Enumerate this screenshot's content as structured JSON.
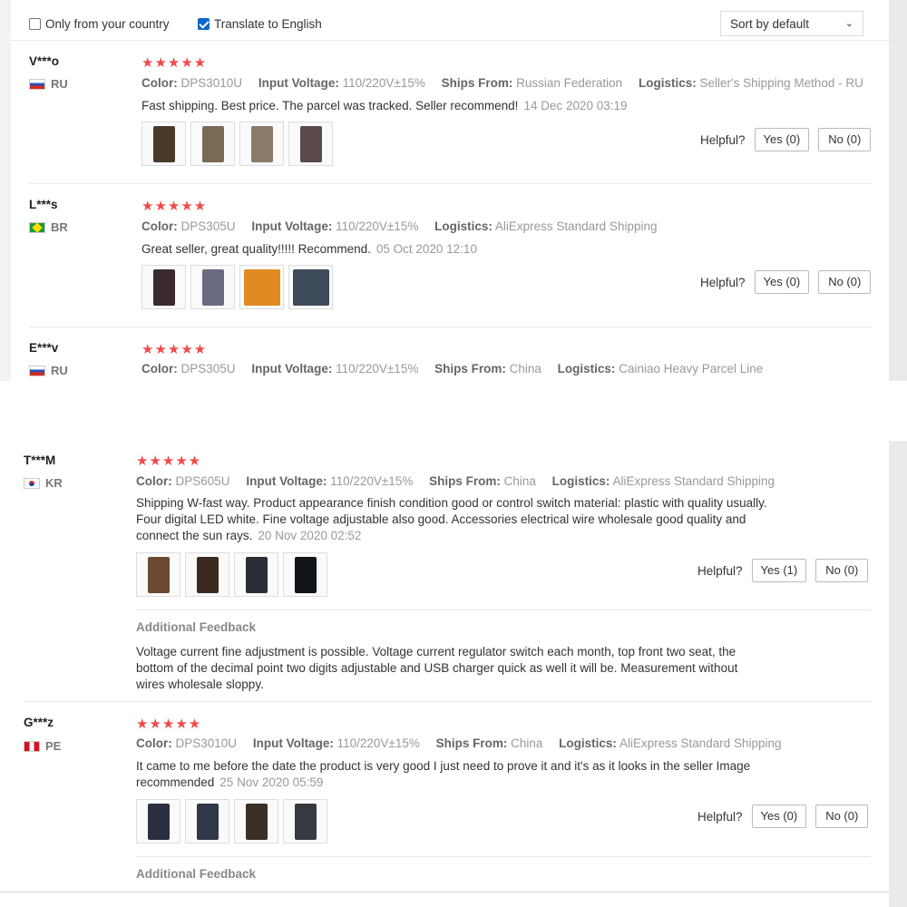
{
  "filters": {
    "only_country_label": "Only from your country",
    "only_country_checked": false,
    "translate_label": "Translate to English",
    "translate_checked": true,
    "sort_value": "Sort by default"
  },
  "helpful_label": "Helpful?",
  "additional_feedback_label": "Additional Feedback",
  "stars_display": "★★★★★",
  "attr_keys": {
    "color": "Color:",
    "input_voltage": "Input Voltage:",
    "ships_from": "Ships From:",
    "logistics": "Logistics:"
  },
  "reviews": [
    {
      "user": "V***o",
      "country": "RU",
      "rating": 5,
      "color": "DPS3010U",
      "input_voltage": "110/220V±15%",
      "ships_from": "Russian Federation",
      "logistics": "Seller's Shipping Method - RU",
      "text": "Fast shipping. Best price. The parcel was tracked. Seller recommend!",
      "date": "14 Dec 2020 03:19",
      "yes": "Yes (0)",
      "no": "No (0)",
      "photos": 4
    },
    {
      "user": "L***s",
      "country": "BR",
      "rating": 5,
      "color": "DPS305U",
      "input_voltage": "110/220V±15%",
      "logistics": "AliExpress Standard Shipping",
      "text": "Great seller, great quality!!!!! Recommend.",
      "date": "05 Oct 2020 12:10",
      "yes": "Yes (0)",
      "no": "No (0)",
      "photos": 4
    },
    {
      "user": "E***v",
      "country": "RU",
      "rating": 5,
      "color": "DPS305U",
      "input_voltage": "110/220V±15%",
      "ships_from": "China",
      "logistics": "Cainiao Heavy Parcel Line"
    },
    {
      "user": "T***M",
      "country": "KR",
      "rating": 5,
      "color": "DPS605U",
      "input_voltage": "110/220V±15%",
      "ships_from": "China",
      "logistics": "AliExpress Standard Shipping",
      "text_lines": [
        "Shipping W-fast way. Product appearance finish condition good or control switch material: plastic with quality usually.",
        "Four digital LED white. Fine voltage adjustable also good. Accessories electrical wire wholesale good quality and",
        "connect the sun rays."
      ],
      "date": "20 Nov 2020 02:52",
      "yes": "Yes (1)",
      "no": "No (0)",
      "photos": 4,
      "additional_feedback_lines": [
        "Voltage current fine adjustment is possible. Voltage current regulator switch each month, top front two seat, the",
        "bottom of the decimal point two digits adjustable and USB charger quick as well it will be. Measurement without",
        "wires wholesale sloppy."
      ]
    },
    {
      "user": "G***z",
      "country": "PE",
      "rating": 5,
      "color": "DPS3010U",
      "input_voltage": "110/220V±15%",
      "ships_from": "China",
      "logistics": "AliExpress Standard Shipping",
      "text_lines": [
        "It came to me before the date the product is very good I just need to prove it and it's as it looks in the seller Image",
        "recommended"
      ],
      "date": "25 Nov 2020 05:59",
      "yes": "Yes (0)",
      "no": "No (0)",
      "photos": 4
    }
  ]
}
